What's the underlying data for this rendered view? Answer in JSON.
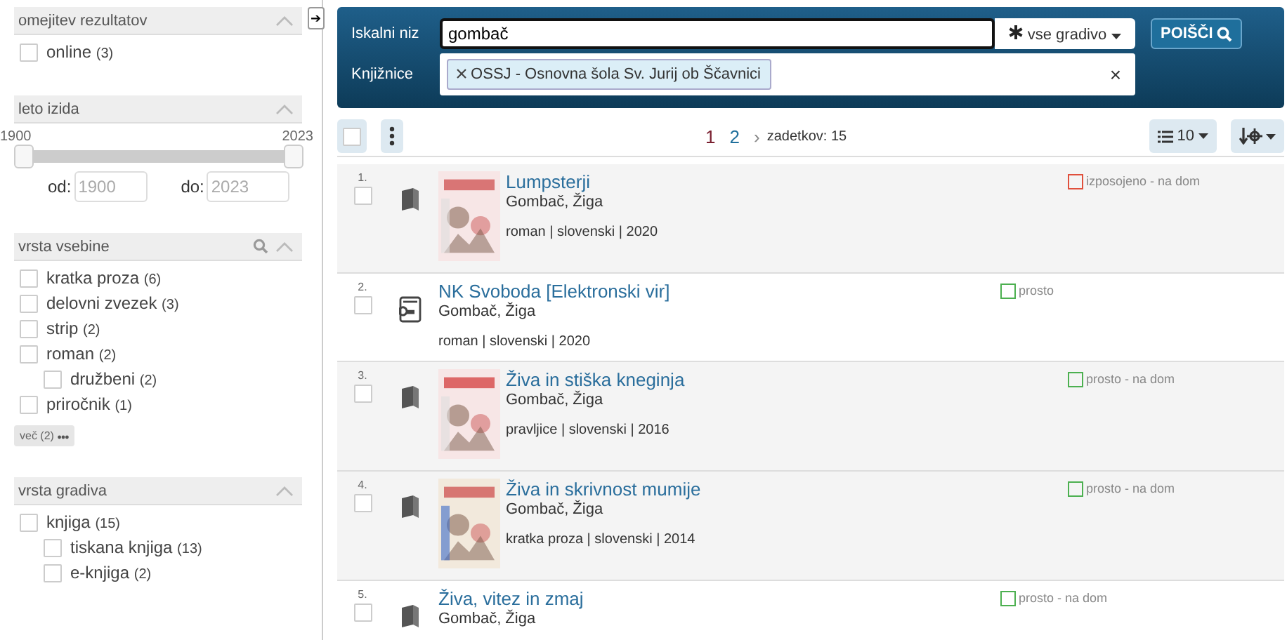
{
  "sidebar": {
    "toggle": "➔",
    "sections": [
      {
        "title": "omejitev rezultatov",
        "search": false,
        "items": [
          {
            "label": "online",
            "count": "(3)",
            "checked": false
          }
        ]
      },
      {
        "title": "leto izida",
        "search": false,
        "kind": "range",
        "min_label": "1900",
        "max_label": "2023",
        "thumbs": [
          {
            "level": 0
          },
          {
            "level": 1
          }
        ],
        "from_label": "od:",
        "from_value": "1900",
        "to_label": "do:",
        "to_value": "2023"
      },
      {
        "title": "vrsta vsebine",
        "search": true,
        "items": [
          {
            "label": "kratka proza",
            "count": "(6)",
            "checked": false
          },
          {
            "label": "delovni zvezek",
            "count": "(3)",
            "checked": false
          },
          {
            "label": "strip",
            "count": "(2)",
            "checked": false
          },
          {
            "label": "roman",
            "count": "(2)",
            "checked": false,
            "children": [
              {
                "label": "družbeni",
                "count": "(2)",
                "checked": false
              }
            ]
          },
          {
            "label": "priročnik",
            "count": "(1)",
            "checked": false
          }
        ],
        "more": "več (2)"
      },
      {
        "title": "vrsta gradiva",
        "search": false,
        "items": [
          {
            "label": "knjiga",
            "count": "(15)",
            "checked": false,
            "children": [
              {
                "label": "tiskana knjiga",
                "count": "(13)",
                "checked": false
              },
              {
                "label": "e-knjiga",
                "count": "(2)",
                "checked": false
              }
            ]
          }
        ]
      }
    ]
  },
  "search": {
    "query_label": "Iskalni niz",
    "query": "gombač",
    "material": "vse gradivo",
    "submit": "POIŠČI",
    "libraries_label": "Knjižnice",
    "libraries": [
      "OSSJ - Osnovna šola Sv. Jurij ob Ščavnici"
    ],
    "clear": "×"
  },
  "toolbar": {
    "select_all_checked": false,
    "pages": [
      {
        "label": "1",
        "selected": true
      },
      {
        "label": "2",
        "selected": false
      }
    ],
    "next": "›",
    "hits": "zadetkov: 15",
    "per_page": "10"
  },
  "results": [
    {
      "number": "1.",
      "checked": false,
      "kind": "book",
      "cover": true,
      "title": "Lumpsterji",
      "author": "Gombač, Žiga",
      "meta": "roman | slovenski | 2020",
      "status": "izposojeno - na dom",
      "color": "#e0503c"
    },
    {
      "number": "2.",
      "checked": false,
      "kind": "ebook",
      "cover": false,
      "title": "NK Svoboda [Elektronski vir]",
      "author": "Gombač, Žiga",
      "meta": "roman | slovenski | 2020",
      "status": "prosto",
      "color": "#4cb050"
    },
    {
      "number": "3.",
      "checked": false,
      "kind": "book",
      "cover": true,
      "title": "Živa in stiška kneginja",
      "author": "Gombač, Žiga",
      "meta": "pravljice | slovenski | 2016",
      "status": "prosto - na dom",
      "color": "#4cb050"
    },
    {
      "number": "4.",
      "checked": false,
      "kind": "book",
      "cover": true,
      "title": "Živa in skrivnost mumije",
      "author": "Gombač, Žiga",
      "meta": "kratka proza | slovenski | 2014",
      "status": "prosto - na dom",
      "color": "#4cb050"
    },
    {
      "number": "5.",
      "checked": false,
      "kind": "book",
      "cover": false,
      "title": "Živa, vitez in zmaj",
      "author": "Gombač, Žiga",
      "status": "prosto - na dom",
      "color": "#4cb050"
    }
  ]
}
